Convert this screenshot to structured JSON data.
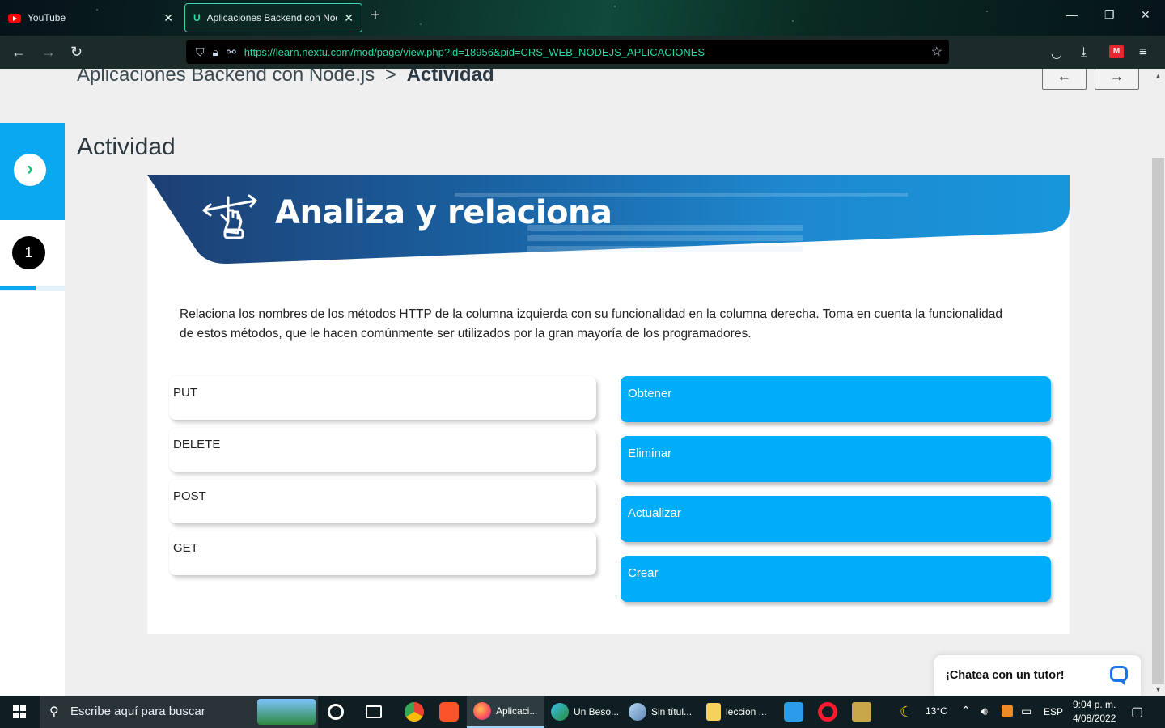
{
  "browser": {
    "tabs": [
      {
        "label": "YouTube",
        "icon": "youtube-icon"
      },
      {
        "label": "Aplicaciones Backend con Node.js",
        "icon": "nextu-favicon-icon",
        "active": true
      }
    ],
    "url": "https://learn.nextu.com/mod/page/view.php?id=18956&pid=CRS_WEB_NODEJS_APLICACIONES"
  },
  "breadcrumb": {
    "course": "Aplicaciones Backend con Node.js",
    "separator": ">",
    "current": "Actividad"
  },
  "pager": {
    "prev": "←",
    "next": "→"
  },
  "sidebar": {
    "step_number": "1",
    "progress_fraction": 0.55
  },
  "page_title": "Actividad",
  "banner": {
    "title": "Analiza y relaciona"
  },
  "instructions": "Relaciona los nombres de los métodos HTTP de la columna izquierda con su funcionalidad en la columna derecha. Toma en cuenta la funcionalidad de estos métodos, que le hacen comúnmente ser utilizados por la gran mayoría de los programadores.",
  "left_items": [
    "PUT",
    "DELETE",
    "POST",
    "GET"
  ],
  "right_items": [
    "Obtener",
    "Eliminar",
    "Actualizar",
    "Crear"
  ],
  "chat": {
    "label": "¡Chatea con un tutor!"
  },
  "taskbar": {
    "search_placeholder": "Escribe aquí para buscar",
    "apps": [
      {
        "label": "Aplicaci...",
        "icon": "firefox-icon"
      },
      {
        "label": "Un Beso...",
        "icon": "edge-icon"
      },
      {
        "label": "Sin títul...",
        "icon": "paint-icon"
      },
      {
        "label": "leccion ...",
        "icon": "folder-icon"
      }
    ],
    "weather": "13°C",
    "language": "ESP",
    "time": "9:04 p. m.",
    "date": "4/08/2022"
  },
  "colors": {
    "accent": "#00adfa",
    "sidebar_accent": "#0aa8ef",
    "url_green": "#2fd7a6"
  }
}
